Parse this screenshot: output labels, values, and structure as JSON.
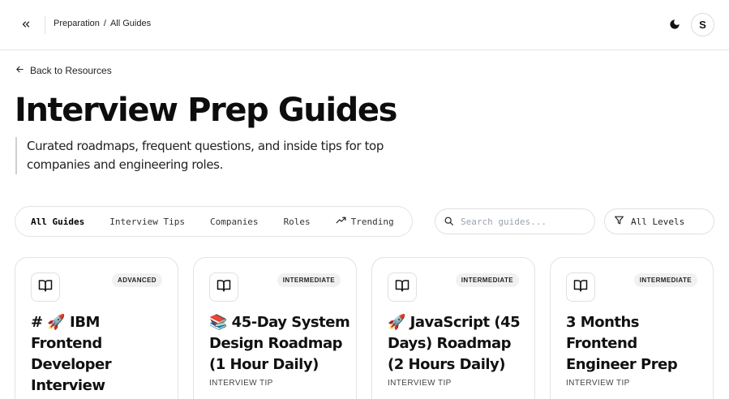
{
  "header": {
    "breadcrumb": [
      "Preparation",
      "/",
      "All Guides"
    ],
    "avatar_initial": "S",
    "icons": {
      "collapse": "chevrons-left-icon",
      "theme": "moon-icon"
    }
  },
  "back_link": {
    "label": "Back to Resources",
    "icon": "arrow-left-icon"
  },
  "page": {
    "title": "Interview Prep Guides",
    "subtitle": "Curated roadmaps, frequent questions, and inside tips for top companies and engineering roles."
  },
  "filters": {
    "tabs": [
      {
        "label": "All Guides",
        "active": true
      },
      {
        "label": "Interview Tips",
        "active": false
      },
      {
        "label": "Companies",
        "active": false
      },
      {
        "label": "Roles",
        "active": false
      },
      {
        "label": "Trending",
        "active": false,
        "icon": "trending-up-icon"
      }
    ],
    "search_placeholder": "Search guides...",
    "search_value": "",
    "level_label": "All Levels",
    "level_icon": "filter-icon"
  },
  "cards": [
    {
      "badge": "ADVANCED",
      "title": "# 🚀 IBM Frontend Developer Interview",
      "type": "",
      "icon": "book-open-icon"
    },
    {
      "badge": "INTERMEDIATE",
      "title": "📚 45-Day System Design Roadmap (1 Hour Daily)",
      "type": "INTERVIEW TIP",
      "icon": "book-open-icon"
    },
    {
      "badge": "INTERMEDIATE",
      "title": "🚀 JavaScript (45 Days) Roadmap (2 Hours Daily)",
      "type": "INTERVIEW TIP",
      "icon": "book-open-icon"
    },
    {
      "badge": "INTERMEDIATE",
      "title": "3 Months Frontend Engineer Prep",
      "type": "INTERVIEW TIP",
      "icon": "book-open-icon"
    }
  ]
}
